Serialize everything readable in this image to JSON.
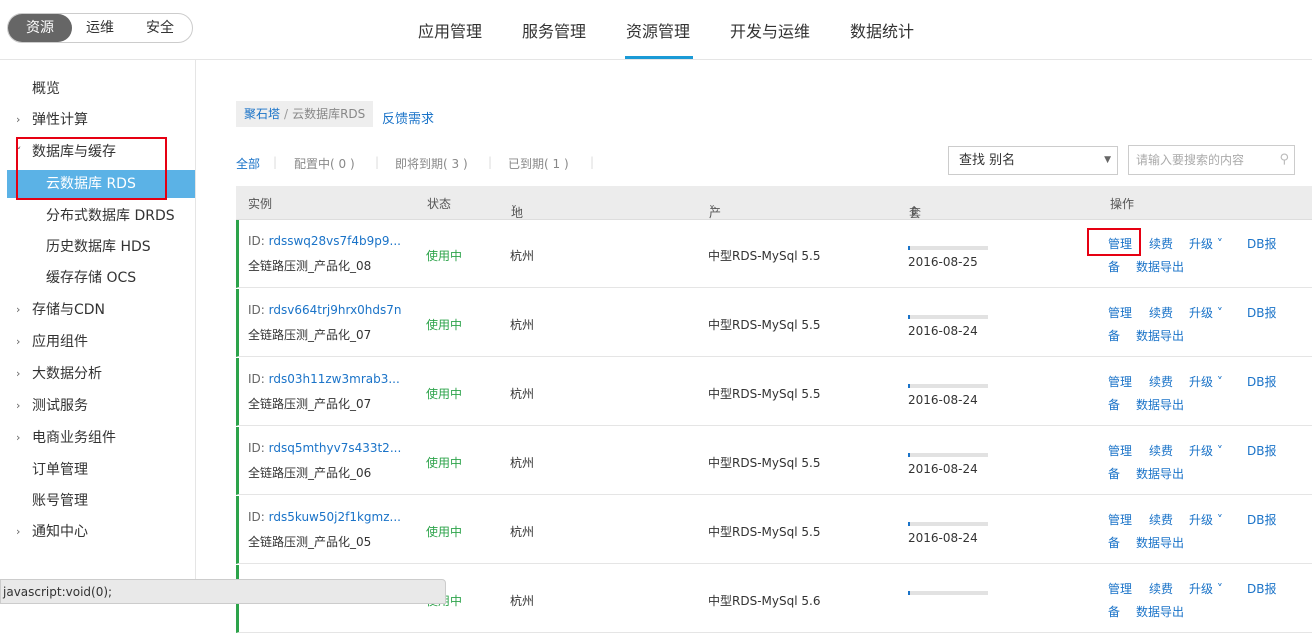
{
  "top_segment": {
    "active": "资源",
    "items": [
      "运维",
      "安全"
    ]
  },
  "top_nav": {
    "items": [
      "应用管理",
      "服务管理",
      "资源管理",
      "开发与运维",
      "数据统计"
    ],
    "active_index": 2
  },
  "sidebar": {
    "items": [
      {
        "label": "概览",
        "arrow": ""
      },
      {
        "label": "弹性计算",
        "arrow": "›"
      },
      {
        "label": "数据库与缓存",
        "arrow": "˅"
      },
      {
        "label": "云数据库 RDS",
        "arrow": ""
      },
      {
        "label": "分布式数据库 DRDS",
        "arrow": ""
      },
      {
        "label": "历史数据库 HDS",
        "arrow": ""
      },
      {
        "label": "缓存存储 OCS",
        "arrow": ""
      },
      {
        "label": "存储与CDN",
        "arrow": "›"
      },
      {
        "label": "应用组件",
        "arrow": "›"
      },
      {
        "label": "大数据分析",
        "arrow": "›"
      },
      {
        "label": "测试服务",
        "arrow": "›"
      },
      {
        "label": "电商业务组件",
        "arrow": "›"
      },
      {
        "label": "订单管理",
        "arrow": ""
      },
      {
        "label": "账号管理",
        "arrow": ""
      },
      {
        "label": "通知中心",
        "arrow": "›"
      }
    ],
    "selected_index": 3
  },
  "status_bar": "javascript:void(0);",
  "breadcrumb": {
    "root": "聚石塔",
    "separator": "/",
    "current": "云数据库RDS"
  },
  "feedback_link": "反馈需求",
  "filters": {
    "all": "全部",
    "configuring": "配置中( 0 )",
    "expiring": "即将到期( 3 )",
    "expired": "已到期( 1 )"
  },
  "search": {
    "select_value": "查找 别名",
    "placeholder": "请输入要搜索的内容"
  },
  "table": {
    "headers": {
      "instance": "实例",
      "status": "状态",
      "region": "地域",
      "spec": "产品规格",
      "duration": "套餐时长",
      "actions": "操作"
    },
    "id_prefix": "ID: ",
    "action_labels": {
      "manage": "管理",
      "renew": "续费",
      "upgrade": "升级",
      "db_report_1": "DB报",
      "db_report_2": "备",
      "export": "数据导出"
    },
    "rows": [
      {
        "id": "rdsswq28vs7f4b9p9...",
        "name": "全链路压测_产品化_08",
        "status": "使用中",
        "region": "杭州",
        "spec": "中型RDS-MySql 5.5",
        "progress": 0.02,
        "date": "2016-08-25"
      },
      {
        "id": "rdsv664trj9hrx0hds7n",
        "name": "全链路压测_产品化_07",
        "status": "使用中",
        "region": "杭州",
        "spec": "中型RDS-MySql 5.5",
        "progress": 0.02,
        "date": "2016-08-24"
      },
      {
        "id": "rds03h11zw3mrab3...",
        "name": "全链路压测_产品化_07",
        "status": "使用中",
        "region": "杭州",
        "spec": "中型RDS-MySql 5.5",
        "progress": 0.02,
        "date": "2016-08-24"
      },
      {
        "id": "rdsq5mthyv7s433t2...",
        "name": "全链路压测_产品化_06",
        "status": "使用中",
        "region": "杭州",
        "spec": "中型RDS-MySql 5.5",
        "progress": 0.02,
        "date": "2016-08-24"
      },
      {
        "id": "rds5kuw50j2f1kgmz...",
        "name": "全链路压测_产品化_05",
        "status": "使用中",
        "region": "杭州",
        "spec": "中型RDS-MySql 5.5",
        "progress": 0.02,
        "date": "2016-08-24"
      },
      {
        "id": "",
        "name": "",
        "status": "使用中",
        "region": "杭州",
        "spec": "中型RDS-MySql 5.6",
        "progress": 0.03,
        "date": ""
      }
    ]
  },
  "colors": {
    "accent": "#1a73c8",
    "selected_bg": "#5bb2e6",
    "status_green": "#2ca34a",
    "highlight_red": "#e60012"
  }
}
